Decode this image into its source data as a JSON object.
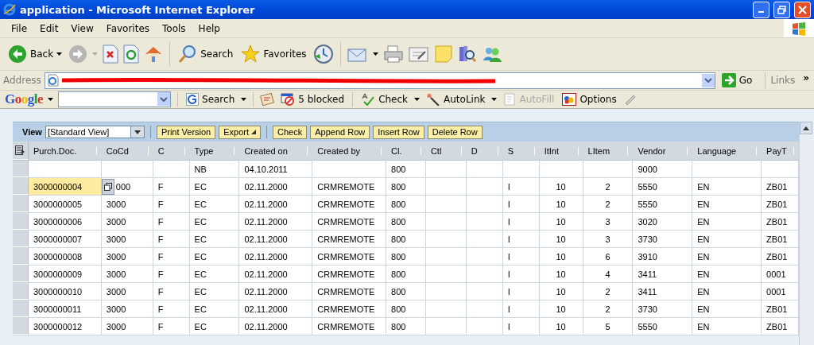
{
  "window": {
    "title": "application - Microsoft Internet Explorer"
  },
  "menu": [
    "File",
    "Edit",
    "View",
    "Favorites",
    "Tools",
    "Help"
  ],
  "toolbar": {
    "back": "Back",
    "search": "Search",
    "favorites": "Favorites"
  },
  "address": {
    "label": "Address",
    "go": "Go",
    "links": "Links",
    "links_more": "»"
  },
  "google_bar": {
    "logo": "Google",
    "search": "Search",
    "blocked": "5 blocked",
    "check": "Check",
    "autolink": "AutoLink",
    "autofill": {
      "label": "AutoFill",
      "disabled": true
    },
    "options": "Options"
  },
  "grid_toolbar": {
    "view_label": "View",
    "view_value": "[Standard View]",
    "buttons": [
      {
        "label": "Print Version",
        "kind": "plain"
      },
      {
        "label": "Export",
        "kind": "menu"
      },
      {
        "label": "Check",
        "kind": "plain"
      },
      {
        "label": "Append Row",
        "kind": "plain"
      },
      {
        "label": "Insert Row",
        "kind": "plain"
      },
      {
        "label": "Delete Row",
        "kind": "plain"
      }
    ]
  },
  "table": {
    "columns": [
      "Purch.Doc.",
      "CoCd",
      "C",
      "Type",
      "Created on",
      "Created by",
      "Cl.",
      "Ctl",
      "D",
      "S",
      "ItInt",
      "LItem",
      "Vendor",
      "Language",
      "PayT"
    ],
    "rows": [
      {
        "editing": false,
        "cells": [
          null,
          null,
          null,
          "NB",
          "04.10.2011",
          null,
          "800",
          null,
          null,
          null,
          null,
          null,
          "9000",
          null,
          null
        ]
      },
      {
        "editing": true,
        "cells": [
          "3000000004",
          "000",
          "F",
          "EC",
          "02.11.2000",
          "CRMREMOTE",
          "800",
          null,
          null,
          "I",
          "10",
          "2",
          "5550",
          "EN",
          "ZB01"
        ]
      },
      {
        "editing": false,
        "cells": [
          "3000000005",
          "3000",
          "F",
          "EC",
          "02.11.2000",
          "CRMREMOTE",
          "800",
          null,
          null,
          "I",
          "10",
          "2",
          "5550",
          "EN",
          "ZB01"
        ]
      },
      {
        "editing": false,
        "cells": [
          "3000000006",
          "3000",
          "F",
          "EC",
          "02.11.2000",
          "CRMREMOTE",
          "800",
          null,
          null,
          "I",
          "10",
          "3",
          "3020",
          "EN",
          "ZB01"
        ]
      },
      {
        "editing": false,
        "cells": [
          "3000000007",
          "3000",
          "F",
          "EC",
          "02.11.2000",
          "CRMREMOTE",
          "800",
          null,
          null,
          "I",
          "10",
          "3",
          "3730",
          "EN",
          "ZB01"
        ]
      },
      {
        "editing": false,
        "cells": [
          "3000000008",
          "3000",
          "F",
          "EC",
          "02.11.2000",
          "CRMREMOTE",
          "800",
          null,
          null,
          "I",
          "10",
          "6",
          "3910",
          "EN",
          "ZB01"
        ]
      },
      {
        "editing": false,
        "cells": [
          "3000000009",
          "3000",
          "F",
          "EC",
          "02.11.2000",
          "CRMREMOTE",
          "800",
          null,
          null,
          "I",
          "10",
          "4",
          "3411",
          "EN",
          "0001"
        ]
      },
      {
        "editing": false,
        "cells": [
          "3000000010",
          "3000",
          "F",
          "EC",
          "02.11.2000",
          "CRMREMOTE",
          "800",
          null,
          null,
          "I",
          "10",
          "2",
          "3411",
          "EN",
          "0001"
        ]
      },
      {
        "editing": false,
        "cells": [
          "3000000011",
          "3000",
          "F",
          "EC",
          "02.11.2000",
          "CRMREMOTE",
          "800",
          null,
          null,
          "I",
          "10",
          "2",
          "3730",
          "EN",
          "ZB01"
        ]
      },
      {
        "editing": false,
        "cells": [
          "3000000012",
          "3000",
          "F",
          "EC",
          "02.11.2000",
          "CRMREMOTE",
          "800",
          null,
          null,
          "I",
          "10",
          "5",
          "5550",
          "EN",
          "ZB01"
        ]
      }
    ]
  }
}
